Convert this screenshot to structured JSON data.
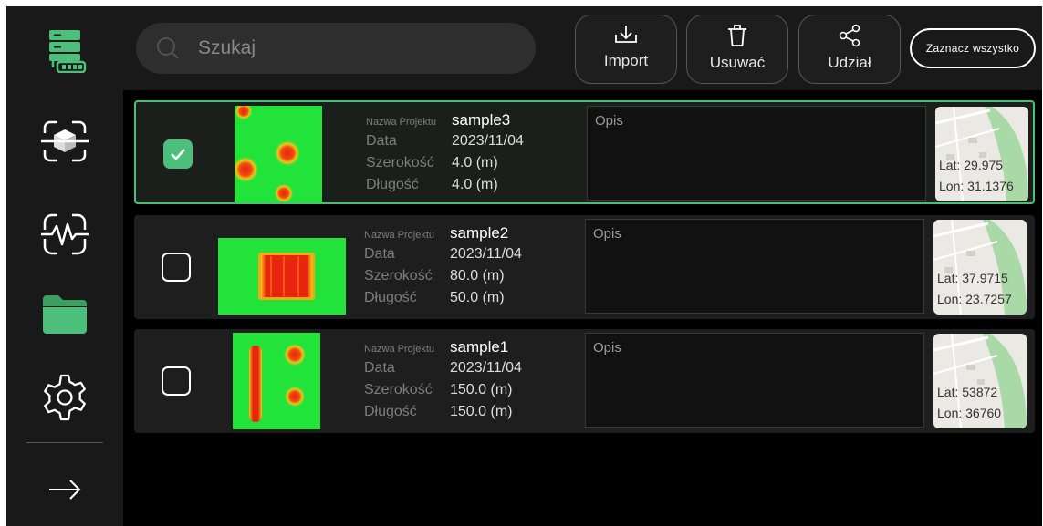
{
  "search": {
    "placeholder": "Szukaj"
  },
  "toolbar": {
    "import_label": "Import",
    "delete_label": "Usuwać",
    "share_label": "Udział",
    "select_all_label": "Zaznacz wszystko"
  },
  "field_labels": {
    "project_name": "Nazwa Projektu",
    "date": "Data",
    "width": "Szerokość",
    "length": "Długość"
  },
  "projects": [
    {
      "selected": true,
      "name": "sample3",
      "date": "2023/11/04",
      "width": "4.0 (m)",
      "length": "4.0 (m)",
      "description": "Opis",
      "lat": "Lat: 29.975",
      "lon": "Lon: 31.1376"
    },
    {
      "selected": false,
      "name": "sample2",
      "date": "2023/11/04",
      "width": "80.0 (m)",
      "length": "50.0 (m)",
      "description": "Opis",
      "lat": "Lat: 37.9715",
      "lon": "Lon: 23.7257"
    },
    {
      "selected": false,
      "name": "sample1",
      "date": "2023/11/04",
      "width": "150.0 (m)",
      "length": "150.0 (m)",
      "description": "Opis",
      "lat": "Lat: 53872",
      "lon": "Lon: 36760"
    }
  ],
  "colors": {
    "accent": "#4cc07a",
    "background": "#000000",
    "panel": "#191919",
    "heat_low": "#22e33a",
    "heat_high": "#e8250f"
  }
}
